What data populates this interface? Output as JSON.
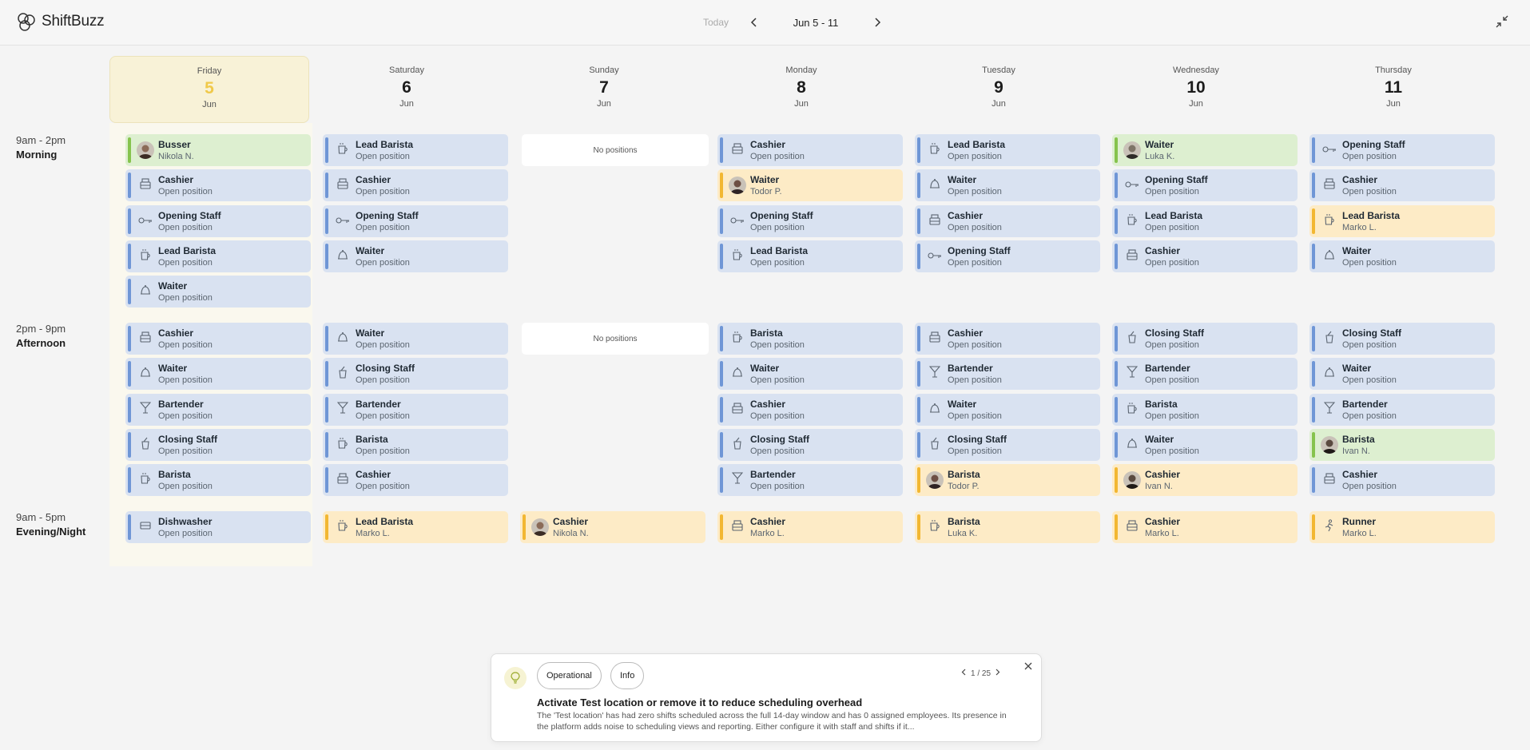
{
  "app": {
    "name": "ShiftBuzz"
  },
  "nav": {
    "today": "Today",
    "range": "Jun 5 - 11"
  },
  "days": [
    {
      "name": "Friday",
      "num": "5",
      "month": "Jun"
    },
    {
      "name": "Saturday",
      "num": "6",
      "month": "Jun"
    },
    {
      "name": "Sunday",
      "num": "7",
      "month": "Jun"
    },
    {
      "name": "Monday",
      "num": "8",
      "month": "Jun"
    },
    {
      "name": "Tuesday",
      "num": "9",
      "month": "Jun"
    },
    {
      "name": "Wednesday",
      "num": "10",
      "month": "Jun"
    },
    {
      "name": "Thursday",
      "num": "11",
      "month": "Jun"
    }
  ],
  "periods": [
    {
      "time": "9am - 2pm",
      "name": "Morning"
    },
    {
      "time": "2pm - 9pm",
      "name": "Afternoon"
    },
    {
      "time": "9am - 5pm",
      "name": "Evening/Night"
    }
  ],
  "no_positions": "No positions",
  "shifts": [
    [
      [
        {
          "role": "Busser",
          "who": "Nikola N.",
          "status": "assigned",
          "icon": "avatar-nikola"
        },
        {
          "role": "Cashier",
          "who": "Open position",
          "status": "open",
          "icon": "register-icon"
        },
        {
          "role": "Opening Staff",
          "who": "Open position",
          "status": "open",
          "icon": "key-icon"
        },
        {
          "role": "Lead Barista",
          "who": "Open position",
          "status": "open",
          "icon": "coffee-cup-icon"
        },
        {
          "role": "Waiter",
          "who": "Open position",
          "status": "open",
          "icon": "cloche-icon"
        }
      ],
      [
        {
          "role": "Cashier",
          "who": "Open position",
          "status": "open",
          "icon": "register-icon"
        },
        {
          "role": "Waiter",
          "who": "Open position",
          "status": "open",
          "icon": "cloche-icon"
        },
        {
          "role": "Bartender",
          "who": "Open position",
          "status": "open",
          "icon": "cocktail-icon"
        },
        {
          "role": "Closing Staff",
          "who": "Open position",
          "status": "open",
          "icon": "mop-bucket-icon"
        },
        {
          "role": "Barista",
          "who": "Open position",
          "status": "open",
          "icon": "coffee-cup-icon"
        }
      ],
      [
        {
          "role": "Dishwasher",
          "who": "Open position",
          "status": "open",
          "icon": "dish-icon"
        }
      ]
    ],
    [
      [
        {
          "role": "Lead Barista",
          "who": "Open position",
          "status": "open",
          "icon": "coffee-cup-icon"
        },
        {
          "role": "Cashier",
          "who": "Open position",
          "status": "open",
          "icon": "register-icon"
        },
        {
          "role": "Opening Staff",
          "who": "Open position",
          "status": "open",
          "icon": "key-icon"
        },
        {
          "role": "Waiter",
          "who": "Open position",
          "status": "open",
          "icon": "cloche-icon"
        }
      ],
      [
        {
          "role": "Waiter",
          "who": "Open position",
          "status": "open",
          "icon": "cloche-icon"
        },
        {
          "role": "Closing Staff",
          "who": "Open position",
          "status": "open",
          "icon": "mop-bucket-icon"
        },
        {
          "role": "Bartender",
          "who": "Open position",
          "status": "open",
          "icon": "cocktail-icon"
        },
        {
          "role": "Barista",
          "who": "Open position",
          "status": "open",
          "icon": "coffee-cup-icon"
        },
        {
          "role": "Cashier",
          "who": "Open position",
          "status": "open",
          "icon": "register-icon"
        }
      ],
      [
        {
          "role": "Lead Barista",
          "who": "Marko L.",
          "status": "pending",
          "icon": "coffee-cup-icon"
        }
      ]
    ],
    [
      [],
      [],
      [
        {
          "role": "Cashier",
          "who": "Nikola N.",
          "status": "pending",
          "icon": "avatar-nikola"
        }
      ]
    ],
    [
      [
        {
          "role": "Cashier",
          "who": "Open position",
          "status": "open",
          "icon": "register-icon"
        },
        {
          "role": "Waiter",
          "who": "Todor P.",
          "status": "pending",
          "icon": "avatar-todor"
        },
        {
          "role": "Opening Staff",
          "who": "Open position",
          "status": "open",
          "icon": "key-icon"
        },
        {
          "role": "Lead Barista",
          "who": "Open position",
          "status": "open",
          "icon": "coffee-cup-icon"
        }
      ],
      [
        {
          "role": "Barista",
          "who": "Open position",
          "status": "open",
          "icon": "coffee-cup-icon"
        },
        {
          "role": "Waiter",
          "who": "Open position",
          "status": "open",
          "icon": "cloche-icon"
        },
        {
          "role": "Cashier",
          "who": "Open position",
          "status": "open",
          "icon": "register-icon"
        },
        {
          "role": "Closing Staff",
          "who": "Open position",
          "status": "open",
          "icon": "mop-bucket-icon"
        },
        {
          "role": "Bartender",
          "who": "Open position",
          "status": "open",
          "icon": "cocktail-icon"
        }
      ],
      [
        {
          "role": "Cashier",
          "who": "Marko L.",
          "status": "pending",
          "icon": "register-icon"
        }
      ]
    ],
    [
      [
        {
          "role": "Lead Barista",
          "who": "Open position",
          "status": "open",
          "icon": "coffee-cup-icon"
        },
        {
          "role": "Waiter",
          "who": "Open position",
          "status": "open",
          "icon": "cloche-icon"
        },
        {
          "role": "Cashier",
          "who": "Open position",
          "status": "open",
          "icon": "register-icon"
        },
        {
          "role": "Opening Staff",
          "who": "Open position",
          "status": "open",
          "icon": "key-icon"
        }
      ],
      [
        {
          "role": "Cashier",
          "who": "Open position",
          "status": "open",
          "icon": "register-icon"
        },
        {
          "role": "Bartender",
          "who": "Open position",
          "status": "open",
          "icon": "cocktail-icon"
        },
        {
          "role": "Waiter",
          "who": "Open position",
          "status": "open",
          "icon": "cloche-icon"
        },
        {
          "role": "Closing Staff",
          "who": "Open position",
          "status": "open",
          "icon": "mop-bucket-icon"
        },
        {
          "role": "Barista",
          "who": "Todor P.",
          "status": "pending",
          "icon": "avatar-todor"
        }
      ],
      [
        {
          "role": "Barista",
          "who": "Luka K.",
          "status": "pending",
          "icon": "coffee-cup-icon"
        }
      ]
    ],
    [
      [
        {
          "role": "Waiter",
          "who": "Luka K.",
          "status": "assigned",
          "icon": "avatar-luka"
        },
        {
          "role": "Opening Staff",
          "who": "Open position",
          "status": "open",
          "icon": "key-icon"
        },
        {
          "role": "Lead Barista",
          "who": "Open position",
          "status": "open",
          "icon": "coffee-cup-icon"
        },
        {
          "role": "Cashier",
          "who": "Open position",
          "status": "open",
          "icon": "register-icon"
        }
      ],
      [
        {
          "role": "Closing Staff",
          "who": "Open position",
          "status": "open",
          "icon": "mop-bucket-icon"
        },
        {
          "role": "Bartender",
          "who": "Open position",
          "status": "open",
          "icon": "cocktail-icon"
        },
        {
          "role": "Barista",
          "who": "Open position",
          "status": "open",
          "icon": "coffee-cup-icon"
        },
        {
          "role": "Waiter",
          "who": "Open position",
          "status": "open",
          "icon": "cloche-icon"
        },
        {
          "role": "Cashier",
          "who": "Ivan N.",
          "status": "pending",
          "icon": "avatar-ivan"
        }
      ],
      [
        {
          "role": "Cashier",
          "who": "Marko L.",
          "status": "pending",
          "icon": "register-icon"
        }
      ]
    ],
    [
      [
        {
          "role": "Opening Staff",
          "who": "Open position",
          "status": "open",
          "icon": "key-icon"
        },
        {
          "role": "Cashier",
          "who": "Open position",
          "status": "open",
          "icon": "register-icon"
        },
        {
          "role": "Lead Barista",
          "who": "Marko L.",
          "status": "pending",
          "icon": "coffee-cup-icon"
        },
        {
          "role": "Waiter",
          "who": "Open position",
          "status": "open",
          "icon": "cloche-icon"
        }
      ],
      [
        {
          "role": "Closing Staff",
          "who": "Open position",
          "status": "open",
          "icon": "mop-bucket-icon"
        },
        {
          "role": "Waiter",
          "who": "Open position",
          "status": "open",
          "icon": "cloche-icon"
        },
        {
          "role": "Bartender",
          "who": "Open position",
          "status": "open",
          "icon": "cocktail-icon"
        },
        {
          "role": "Barista",
          "who": "Ivan N.",
          "status": "assigned",
          "icon": "avatar-ivan"
        },
        {
          "role": "Cashier",
          "who": "Open position",
          "status": "open",
          "icon": "register-icon"
        }
      ],
      [
        {
          "role": "Runner",
          "who": "Marko L.",
          "status": "pending",
          "icon": "runner-icon"
        }
      ]
    ]
  ],
  "insight": {
    "tags": [
      "Operational",
      "Info"
    ],
    "pager": "1 / 25",
    "title": "Activate Test location or remove it to reduce scheduling overhead",
    "body": "The 'Test location' has had zero shifts scheduled across the full 14-day window and has 0 assigned employees. Its presence in the platform adds noise to scheduling views and reporting. Either configure it with staff and shifts if it..."
  },
  "colors": {
    "open": "#d9e2f1",
    "open_bar": "#6f96d6",
    "assigned": "#ddefd0",
    "assigned_bar": "#86c34d",
    "pending": "#fdebc6",
    "pending_bar": "#f2b732",
    "today_highlight": "#f0c94a"
  }
}
